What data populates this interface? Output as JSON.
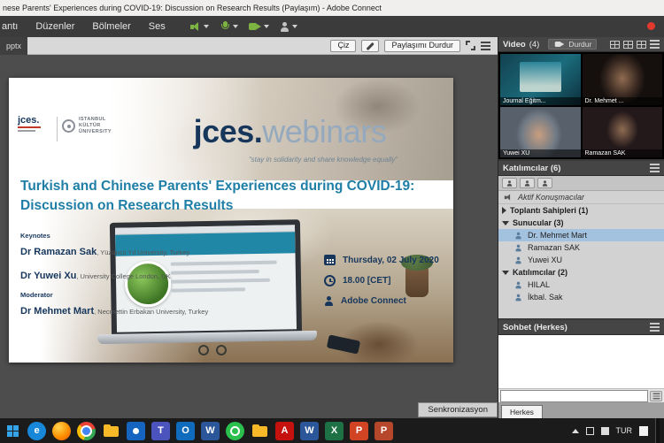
{
  "window": {
    "title": "nese Parents' Experiences during COVID-19: Discussion on Research Results (Paylaşım) - Adobe Connect"
  },
  "menubar": {
    "items": [
      "antı",
      "Düzenler",
      "Bölmeler",
      "Ses"
    ]
  },
  "share_pod": {
    "doc_tab": "pptx",
    "draw_button": "Çiz",
    "stop_sharing_button": "Paylaşımı Durdur",
    "sync_button": "Senkronizasyon"
  },
  "slide": {
    "logo_jces": "jces.",
    "logo_uni": [
      "ISTANBUL",
      "KÜLTÜR",
      "ÜNIVERSITY"
    ],
    "brand_bold": "jces.",
    "brand_light": "webinars",
    "tagline": "“stay in solidarity and share knowledge equally”",
    "title_line1": "Turkish and Chinese Parents' Experiences during COVID-19:",
    "title_line2": "Discussion on Research Results",
    "keynotes_label": "Keynotes",
    "keynotes": [
      {
        "name": "Dr Ramazan Sak",
        "affiliation": ", Yüzüncü Yıl University, Turkey"
      },
      {
        "name": "Dr Yuwei Xu",
        "affiliation": ", University College London, UK"
      }
    ],
    "moderator_label": "Moderator",
    "moderator": {
      "name": "Dr Mehmet Mart",
      "affiliation": ", Necmettin Erbakan University, Turkey"
    },
    "event": {
      "date": "Thursday, 02 July 2020",
      "time": "18.00 [CET]",
      "platform": "Adobe Connect"
    }
  },
  "video_pod": {
    "title": "Video",
    "count": "(4)",
    "stop_button": "Durdur",
    "tiles": [
      {
        "name": "Journal Eğitm..."
      },
      {
        "name": "Dr. Mehmet ..."
      },
      {
        "name": "Yuwei XU"
      },
      {
        "name": "Ramazan SAK"
      }
    ]
  },
  "attendees_pod": {
    "title": "Katılımcılar (6)",
    "active_speakers_label": "Aktif Konuşmacılar",
    "hosts_group": "Toplantı Sahipleri (1)",
    "presenters_group": "Sunucular (3)",
    "participants_group": "Katılımcılar (2)",
    "presenters": [
      "Dr. Mehmet Mart",
      "Ramazan SAK",
      "Yuwei XU"
    ],
    "participants": [
      "HILAL",
      "İkbal. Sak"
    ]
  },
  "chat_pod": {
    "title": "Sohbet  (Herkes)",
    "tab": "Herkes",
    "input_value": ""
  },
  "taskbar": {
    "language": "TUR",
    "icons": [
      {
        "name": "edge-browser",
        "glyph": "e",
        "color": "#1687d9"
      },
      {
        "name": "firefox-browser",
        "glyph": ""
      },
      {
        "name": "chrome-browser",
        "glyph": ""
      },
      {
        "name": "file-explorer-folder",
        "glyph": ""
      },
      {
        "name": "photos-app",
        "glyph": "",
        "color": "#1565c0"
      },
      {
        "name": "teams-app",
        "glyph": "T",
        "color": "#4b53bc"
      },
      {
        "name": "outlook-app",
        "glyph": "O",
        "color": "#0f6cbd"
      },
      {
        "name": "word-app",
        "glyph": "W",
        "color": "#2b579a"
      },
      {
        "name": "whatsapp-app",
        "glyph": ""
      },
      {
        "name": "downloads-folder",
        "glyph": ""
      },
      {
        "name": "acrobat-app",
        "glyph": "A",
        "color": "#c6120f"
      },
      {
        "name": "word-document",
        "glyph": "W",
        "color": "#2b579a"
      },
      {
        "name": "excel-app",
        "glyph": "X",
        "color": "#1e7145"
      },
      {
        "name": "powerpoint-app",
        "glyph": "P",
        "color": "#d04423"
      },
      {
        "name": "powerpoint-document",
        "glyph": "P",
        "color": "#b7472a"
      }
    ]
  }
}
